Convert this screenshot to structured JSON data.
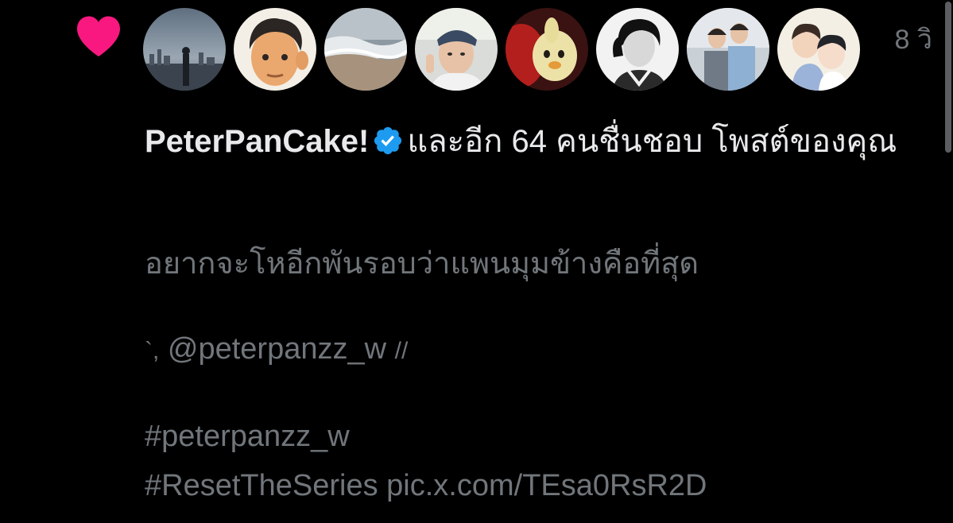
{
  "notification": {
    "type_icon": "heart-icon",
    "timestamp": "8 วิ",
    "avatars": [
      {
        "name": "avatar-1-city-skyline"
      },
      {
        "name": "avatar-2-cartoon-man"
      },
      {
        "name": "avatar-3-beach-waves"
      },
      {
        "name": "avatar-4-man-bandana"
      },
      {
        "name": "avatar-5-plush-toy"
      },
      {
        "name": "avatar-6-bw-portrait"
      },
      {
        "name": "avatar-7-two-men"
      },
      {
        "name": "avatar-8-illustration"
      }
    ],
    "user_name": "PeterPanCake!",
    "action_text": "และอีก 64 คนชื่นชอบ โพสต์ของคุณ",
    "post": {
      "line1": "อยากจะโหอีกพันรอบว่าแพนมุมข้างคือที่สุด",
      "mention_prefix": "`,",
      "mention": "@peterpanzz_w",
      "mention_suffix": "//",
      "hashtag1": "#peterpanzz_w",
      "hashtag2": "#ResetTheSeries",
      "link": "pic.x.com/TEsa0RsR2D"
    }
  },
  "colors": {
    "background": "#000000",
    "heart": "#f91880",
    "verified": "#1d9bf0",
    "primary_text": "#e7e9ea",
    "secondary_text": "#71767b"
  }
}
